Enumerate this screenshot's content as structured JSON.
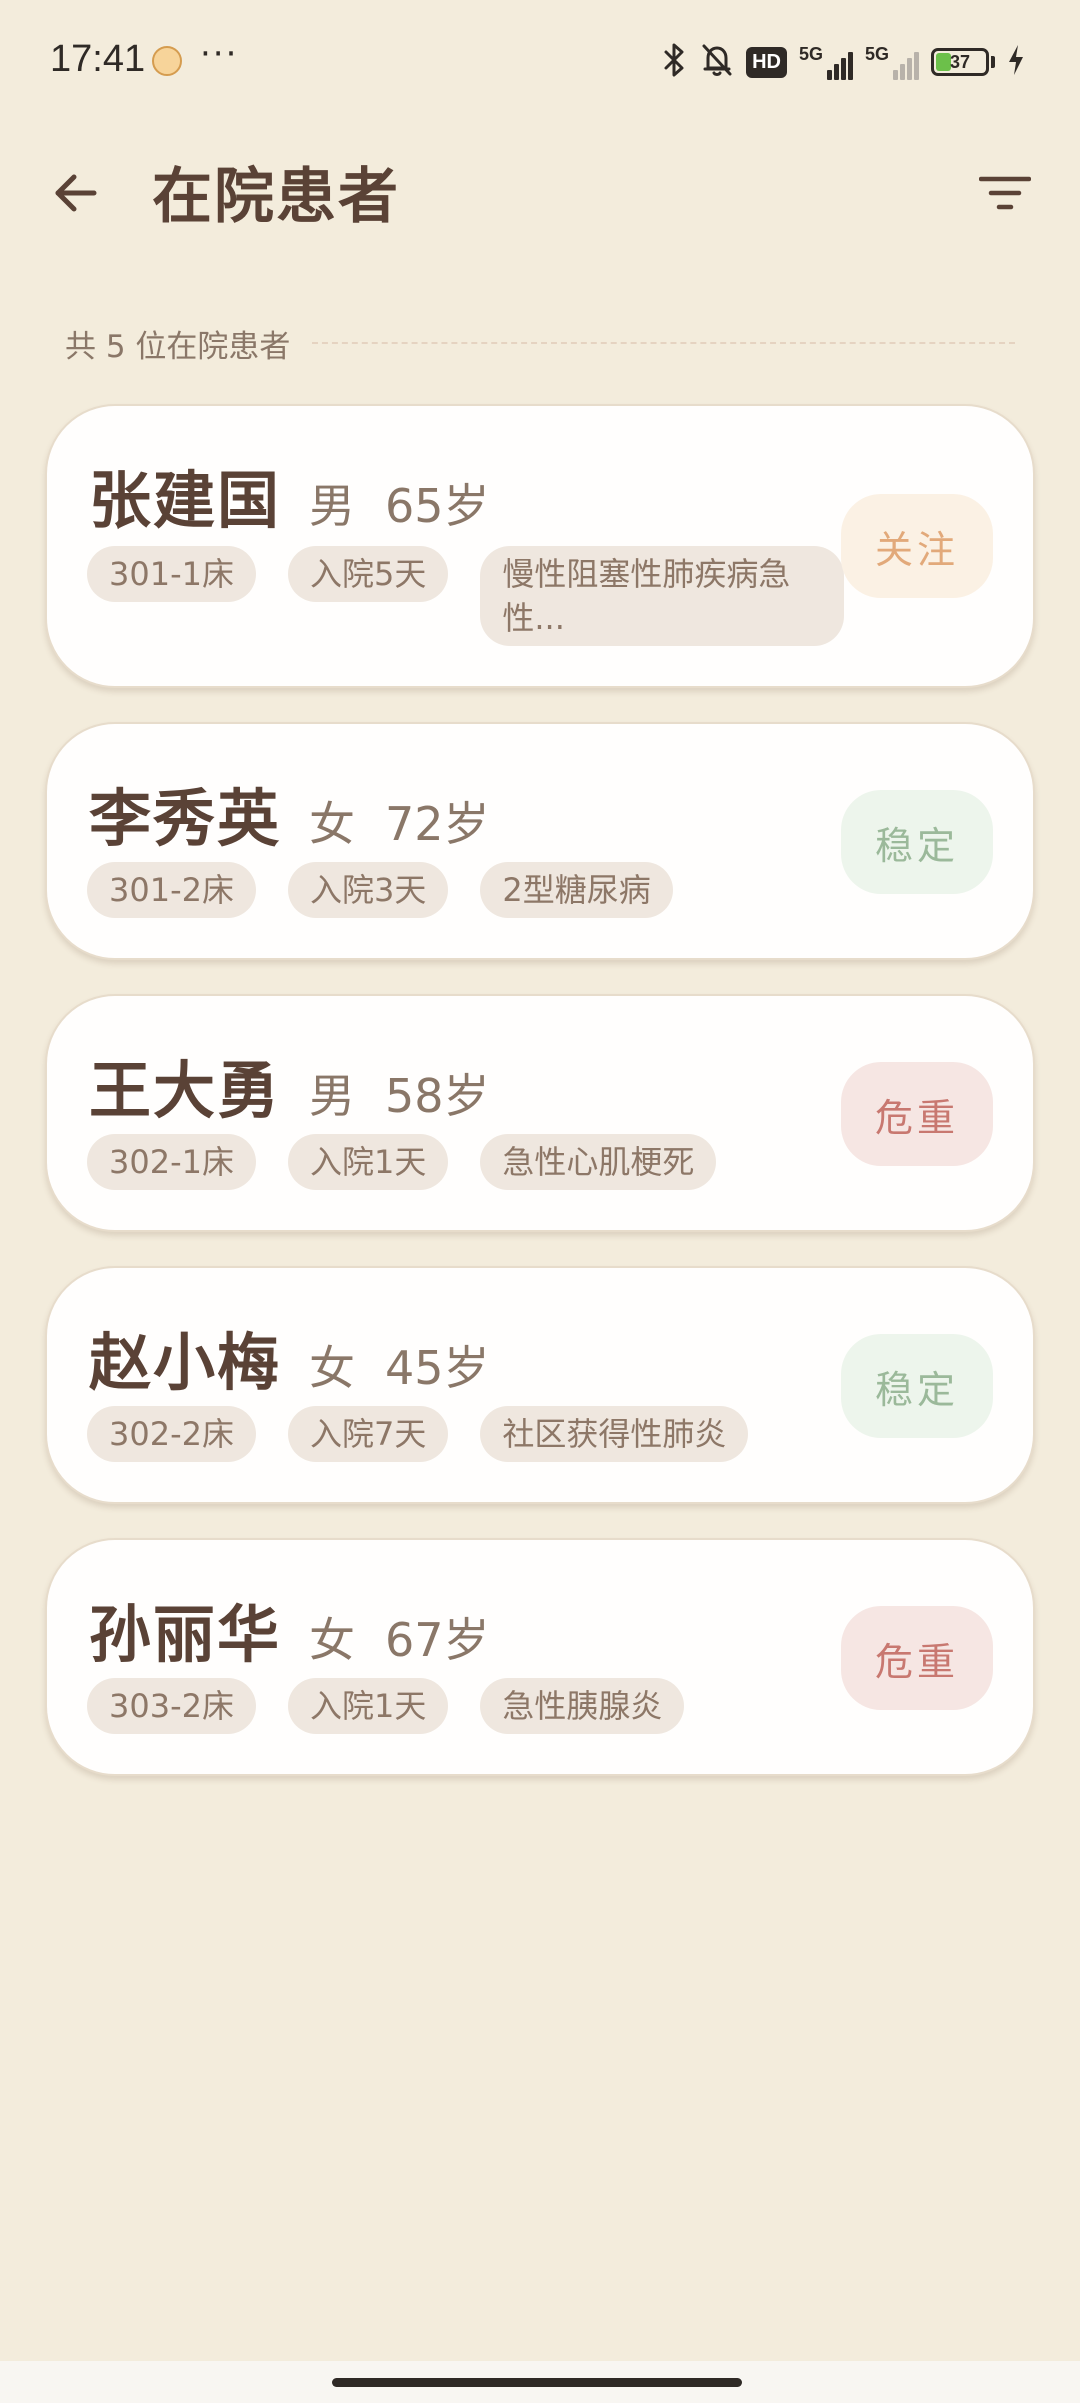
{
  "status_bar": {
    "time": "17:41",
    "network_type_1": "5G",
    "network_type_2": "5G",
    "battery_level": "37",
    "hd_label": "HD"
  },
  "app_bar": {
    "title": "在院患者"
  },
  "summary": {
    "count_text": "共 5 位在院患者"
  },
  "patients": [
    {
      "name": "张建国",
      "gender": "男",
      "age": "65岁",
      "bed": "301-1床",
      "days": "入院5天",
      "diagnosis": "慢性阻塞性肺疾病急性...",
      "status": "关注"
    },
    {
      "name": "李秀英",
      "gender": "女",
      "age": "72岁",
      "bed": "301-2床",
      "days": "入院3天",
      "diagnosis": "2型糖尿病",
      "status": "稳定"
    },
    {
      "name": "王大勇",
      "gender": "男",
      "age": "58岁",
      "bed": "302-1床",
      "days": "入院1天",
      "diagnosis": "急性心肌梗死",
      "status": "危重"
    },
    {
      "name": "赵小梅",
      "gender": "女",
      "age": "45岁",
      "bed": "302-2床",
      "days": "入院7天",
      "diagnosis": "社区获得性肺炎",
      "status": "稳定"
    },
    {
      "name": "孙丽华",
      "gender": "女",
      "age": "67岁",
      "bed": "303-2床",
      "days": "入院1天",
      "diagnosis": "急性胰腺炎",
      "status": "危重"
    }
  ],
  "icons": {
    "back": "arrow-left-icon",
    "filter": "filter-icon",
    "bluetooth": "bluetooth-icon",
    "mute": "bell-off-icon",
    "charging": "lightning-icon"
  },
  "colors": {
    "background": "#f3ecdc",
    "status_watch": "#e2a97a",
    "status_stable": "#9bb99a",
    "status_critical": "#c87870"
  }
}
